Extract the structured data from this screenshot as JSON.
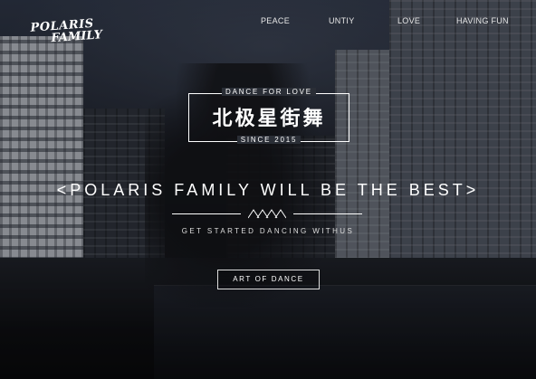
{
  "brand": {
    "line1": "POLARIS",
    "line2": "FAMILY"
  },
  "nav": {
    "items": [
      {
        "label": "PEACE"
      },
      {
        "label": "UNTIY"
      },
      {
        "label": "LOVE"
      },
      {
        "label": "HAVING FUN"
      }
    ]
  },
  "badge": {
    "top": "DANCE FOR LOVE",
    "chinese": "北极星街舞",
    "bottom": "SINCE 2015"
  },
  "hero": {
    "headline": "<POLARIS FAMILY WILL BE THE BEST>",
    "subheadline": "GET STARTED DANCING WITHUS",
    "cta_label": "ART OF DANCE"
  },
  "colors": {
    "text": "#ffffff",
    "background": "#1a1d23"
  }
}
